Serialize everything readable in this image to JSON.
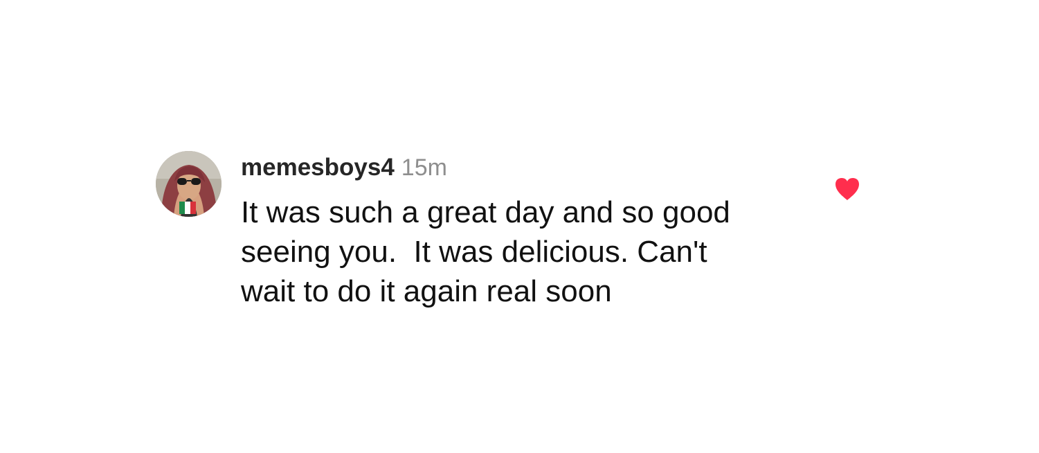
{
  "comment": {
    "username": "memesboys4",
    "timestamp": "15m",
    "text": "It was such a great day and so good\nseeing you.  It was delicious. Can't\nwait to do it again real soon",
    "liked": true
  },
  "icons": {
    "like": "heart-icon",
    "avatar": "profile-photo"
  },
  "colors": {
    "username": "#262626",
    "timestamp": "#8e8e8e",
    "text": "#111111",
    "heart": "#ff2e4d",
    "background": "#ffffff"
  }
}
